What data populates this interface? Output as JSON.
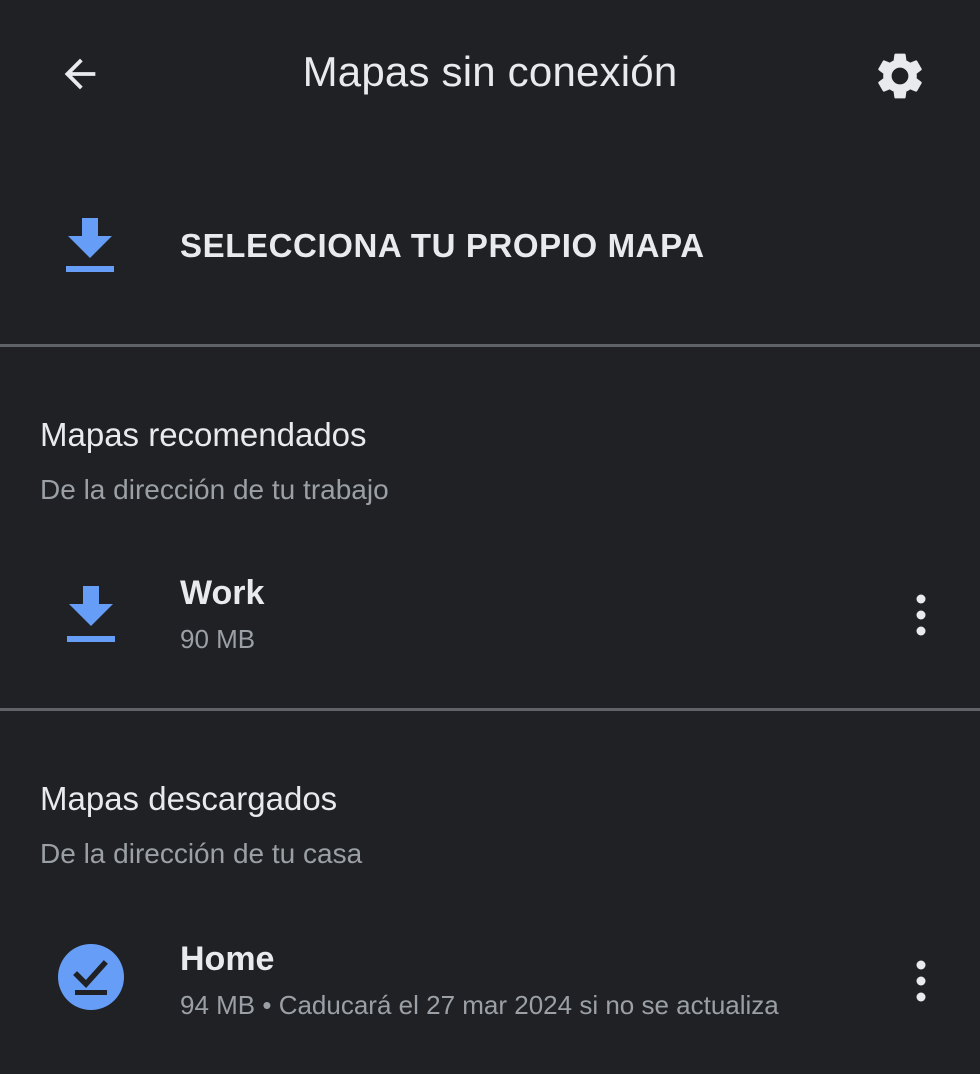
{
  "header": {
    "title": "Mapas sin conexión",
    "back_icon": "arrow-left-icon",
    "settings_icon": "gear-icon"
  },
  "select_map": {
    "label": "SELECCIONA TU PROPIO MAPA",
    "icon": "download-icon"
  },
  "recommended": {
    "title": "Mapas recomendados",
    "subtitle": "De la dirección de tu trabajo",
    "items": [
      {
        "name": "Work",
        "detail": "90 MB",
        "icon": "download-icon"
      }
    ]
  },
  "downloaded": {
    "title": "Mapas descargados",
    "subtitle": "De la dirección de tu casa",
    "items": [
      {
        "name": "Home",
        "detail": "94 MB • Caducará el 27 mar 2024 si no se actualiza",
        "icon": "downloaded-check-icon"
      }
    ]
  },
  "colors": {
    "background": "#202124",
    "accent": "#669df6",
    "text_primary": "#e8eaed",
    "text_secondary": "#9aa0a6",
    "divider": "#5f6368"
  }
}
